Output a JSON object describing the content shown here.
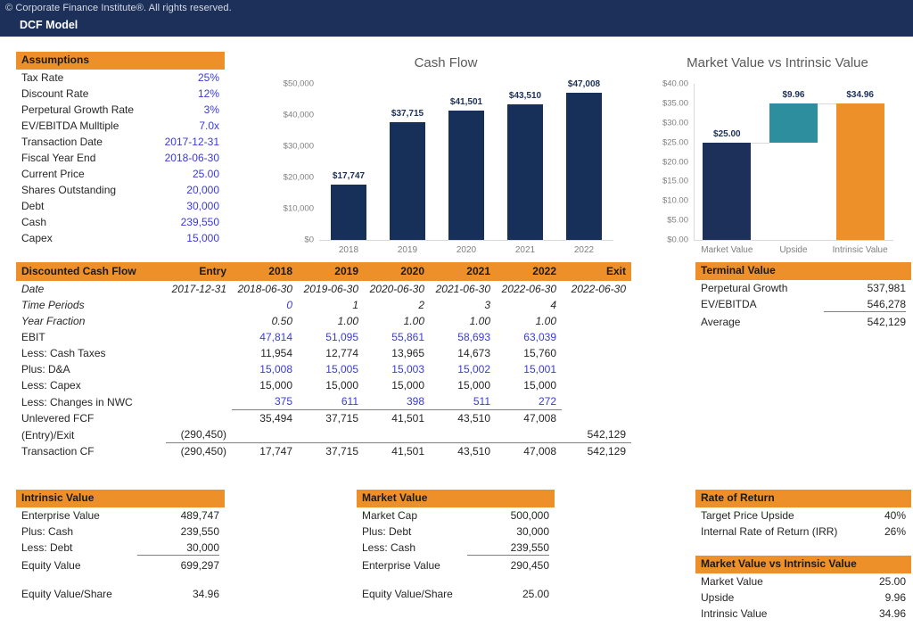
{
  "window": {
    "copyright": "© Corporate Finance Institute®. All rights reserved.",
    "title": "DCF Model"
  },
  "colors": {
    "navy": "#1C3059",
    "orange": "#ED9029",
    "teal": "#2D8E9E",
    "input_blue": "#3A3ADB",
    "bar_navy": "#16305A"
  },
  "assumptions": {
    "header": "Assumptions",
    "rows": [
      {
        "label": "Tax Rate",
        "value": "25%",
        "blue": true
      },
      {
        "label": "Discount Rate",
        "value": "12%",
        "blue": true
      },
      {
        "label": "Perpetural Growth Rate",
        "value": "3%",
        "blue": true
      },
      {
        "label": "EV/EBITDA Mulltiple",
        "value": "7.0x",
        "blue": true
      },
      {
        "label": "Transaction Date",
        "value": "2017-12-31",
        "blue": true
      },
      {
        "label": "Fiscal Year End",
        "value": "2018-06-30",
        "blue": true
      },
      {
        "label": "Current Price",
        "value": "25.00",
        "blue": true
      },
      {
        "label": "Shares Outstanding",
        "value": "20,000",
        "blue": true
      },
      {
        "label": "Debt",
        "value": "30,000",
        "blue": true
      },
      {
        "label": "Cash",
        "value": "239,550",
        "blue": true
      },
      {
        "label": "Capex",
        "value": "15,000",
        "blue": true
      }
    ]
  },
  "chart_data": [
    {
      "id": "cash-flow",
      "type": "bar",
      "title": "Cash Flow",
      "categories": [
        "2018",
        "2019",
        "2020",
        "2021",
        "2022"
      ],
      "values": [
        17747,
        37715,
        41501,
        43510,
        47008
      ],
      "data_labels": [
        "$17,747",
        "$37,715",
        "$41,501",
        "$43,510",
        "$47,008"
      ],
      "xlabel": "",
      "ylabel": "",
      "ylim": [
        0,
        50000
      ],
      "ytick_values": [
        0,
        10000,
        20000,
        30000,
        40000,
        50000
      ],
      "ytick_labels": [
        "$0",
        "$10,000",
        "$20,000",
        "$30,000",
        "$40,000",
        "$50,000"
      ],
      "grid": false,
      "legend": "none",
      "series_color": "#16305A"
    },
    {
      "id": "market-vs-intrinsic",
      "type": "bar",
      "subtype": "waterfall",
      "title": "Market Value vs Intrinsic Value",
      "categories": [
        "Market Value",
        "Upside",
        "Intrinsic Value"
      ],
      "values": [
        25.0,
        9.96,
        34.96
      ],
      "bases": [
        0,
        25.0,
        0
      ],
      "data_labels": [
        "$25.00",
        "$9.96",
        "$34.96"
      ],
      "bar_colors": [
        "#1C3059",
        "#2D8E9E",
        "#ED9029"
      ],
      "xlabel": "",
      "ylabel": "",
      "ylim": [
        0,
        40
      ],
      "ytick_values": [
        0,
        5,
        10,
        15,
        20,
        25,
        30,
        35,
        40
      ],
      "ytick_labels": [
        "$0.00",
        "$5.00",
        "$10.00",
        "$15.00",
        "$20.00",
        "$25.00",
        "$30.00",
        "$35.00",
        "$40.00"
      ],
      "grid": false,
      "legend": "none"
    }
  ],
  "dcf": {
    "headers": [
      "Discounted Cash Flow",
      "Entry",
      "2018",
      "2019",
      "2020",
      "2021",
      "2022",
      "Exit"
    ],
    "rows": [
      {
        "label": "Date",
        "italic": true,
        "cells": [
          "2017-12-31",
          "2018-06-30",
          "2019-06-30",
          "2020-06-30",
          "2021-06-30",
          "2022-06-30",
          "2022-06-30"
        ],
        "blue": [
          false,
          false,
          false,
          false,
          false,
          false,
          false
        ]
      },
      {
        "label": "Time Periods",
        "italic": true,
        "cells": [
          "",
          "0",
          "1",
          "2",
          "3",
          "4",
          ""
        ],
        "blue": [
          false,
          true,
          false,
          false,
          false,
          false,
          false
        ]
      },
      {
        "label": "Year Fraction",
        "italic": true,
        "cells": [
          "",
          "0.50",
          "1.00",
          "1.00",
          "1.00",
          "1.00",
          ""
        ],
        "blue": [
          false,
          false,
          false,
          false,
          false,
          false,
          false
        ]
      },
      {
        "label": "EBIT",
        "italic": false,
        "cells": [
          "",
          "47,814",
          "51,095",
          "55,861",
          "58,693",
          "63,039",
          ""
        ],
        "blue": [
          false,
          true,
          true,
          true,
          true,
          true,
          false
        ]
      },
      {
        "label": "Less: Cash Taxes",
        "italic": false,
        "cells": [
          "",
          "11,954",
          "12,774",
          "13,965",
          "14,673",
          "15,760",
          ""
        ],
        "blue": [
          false,
          false,
          false,
          false,
          false,
          false,
          false
        ]
      },
      {
        "label": "Plus: D&A",
        "italic": false,
        "cells": [
          "",
          "15,008",
          "15,005",
          "15,003",
          "15,002",
          "15,001",
          ""
        ],
        "blue": [
          false,
          true,
          true,
          true,
          true,
          true,
          false
        ]
      },
      {
        "label": "Less: Capex",
        "italic": false,
        "cells": [
          "",
          "15,000",
          "15,000",
          "15,000",
          "15,000",
          "15,000",
          ""
        ],
        "blue": [
          false,
          false,
          false,
          false,
          false,
          false,
          false
        ]
      },
      {
        "label": "Less: Changes in NWC",
        "italic": false,
        "cells": [
          "",
          "375",
          "611",
          "398",
          "511",
          "272",
          ""
        ],
        "blue": [
          false,
          true,
          true,
          true,
          true,
          true,
          false
        ],
        "rule": "years"
      },
      {
        "label": "Unlevered FCF",
        "italic": false,
        "cells": [
          "",
          "35,494",
          "37,715",
          "41,501",
          "43,510",
          "47,008",
          ""
        ],
        "blue": [
          false,
          false,
          false,
          false,
          false,
          false,
          false
        ]
      },
      {
        "label": "(Entry)/Exit",
        "italic": false,
        "cells": [
          "(290,450)",
          "",
          "",
          "",
          "",
          "",
          "542,129"
        ],
        "blue": [
          false,
          false,
          false,
          false,
          false,
          false,
          false
        ],
        "rule": "all"
      },
      {
        "label": "Transaction CF",
        "italic": false,
        "cells": [
          "(290,450)",
          "17,747",
          "37,715",
          "41,501",
          "43,510",
          "47,008",
          "542,129"
        ],
        "blue": [
          false,
          false,
          false,
          false,
          false,
          false,
          false
        ]
      }
    ]
  },
  "terminal_value": {
    "header": "Terminal Value",
    "rows": [
      {
        "label": "Perpetural Growth",
        "value": "537,981",
        "underline": false
      },
      {
        "label": "EV/EBITDA",
        "value": "546,278",
        "underline": true
      },
      {
        "label": "Average",
        "value": "542,129",
        "underline": false
      }
    ]
  },
  "intrinsic_value": {
    "header": "Intrinsic Value",
    "rows": [
      {
        "label": "Enterprise Value",
        "value": "489,747",
        "underline": false
      },
      {
        "label": "Plus: Cash",
        "value": "239,550",
        "underline": false
      },
      {
        "label": "Less: Debt",
        "value": "30,000",
        "underline": true
      },
      {
        "label": "Equity Value",
        "value": "699,297",
        "underline": false
      }
    ],
    "per_share_label": "Equity Value/Share",
    "per_share_value": "34.96"
  },
  "market_value": {
    "header": "Market Value",
    "rows": [
      {
        "label": "Market Cap",
        "value": "500,000",
        "underline": false
      },
      {
        "label": "Plus: Debt",
        "value": "30,000",
        "underline": false
      },
      {
        "label": "Less: Cash",
        "value": "239,550",
        "underline": true
      },
      {
        "label": "Enterprise Value",
        "value": "290,450",
        "underline": false
      }
    ],
    "per_share_label": "Equity Value/Share",
    "per_share_value": "25.00"
  },
  "rate_of_return": {
    "header": "Rate of Return",
    "rows": [
      {
        "label": "Target Price Upside",
        "value": "40%",
        "underline": false
      },
      {
        "label": "Internal Rate of Return (IRR)",
        "value": "26%",
        "underline": false
      }
    ]
  },
  "mv_vs_iv_panel": {
    "header": "Market Value vs Intrinsic Value",
    "rows": [
      {
        "label": "Market Value",
        "value": "25.00",
        "underline": false
      },
      {
        "label": "Upside",
        "value": "9.96",
        "underline": false
      },
      {
        "label": "Intrinsic Value",
        "value": "34.96",
        "underline": false
      }
    ]
  }
}
